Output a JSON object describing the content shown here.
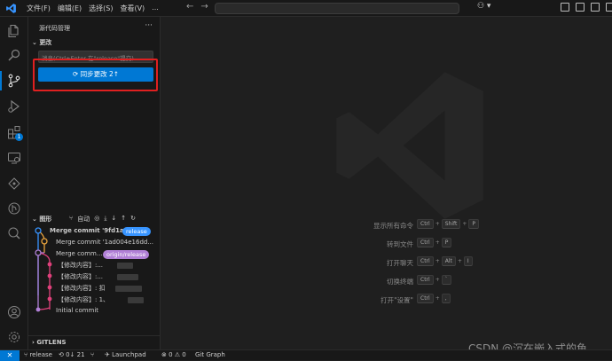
{
  "titlebar": {
    "menu": [
      "文件(F)",
      "编辑(E)",
      "选择(S)",
      "查看(V)",
      "..."
    ],
    "back": "←",
    "forward": "→",
    "copilot": "⚇ ▾"
  },
  "activity": {
    "scm_badge": "",
    "extensions_badge": "1"
  },
  "sidebar": {
    "title": "源代码管理",
    "more": "···",
    "changes_header": "更改",
    "message_placeholder": "消息(Ctrl+Enter 在\"release\"提交)",
    "sync_button": "⟳ 同步更改 2↑",
    "graph_header": "图形",
    "graph_auto": "自动",
    "graph_rows": [
      {
        "text": "Merge commit '9fd1a...",
        "ref": "release",
        "ref_color": "#3794ff"
      },
      {
        "text": "Merge commit '1ad004e16dd..."
      },
      {
        "text": "Merge comm...",
        "ref": "origin/release",
        "ref_color": "#b180d7"
      },
      {
        "text": "【修改内容】:..."
      },
      {
        "text": "【修改内容】:..."
      },
      {
        "text": "【修改内容】:  扣"
      },
      {
        "text": "【修改内容】:  1、"
      },
      {
        "text": "Initial commit"
      }
    ],
    "gitlens": "GITLENS"
  },
  "editor": {
    "shortcuts": [
      {
        "label": "显示所有命令",
        "keys": [
          "Ctrl",
          "Shift",
          "P"
        ]
      },
      {
        "label": "转到文件",
        "keys": [
          "Ctrl",
          "P"
        ]
      },
      {
        "label": "打开聊天",
        "keys": [
          "Ctrl",
          "Alt",
          "I"
        ]
      },
      {
        "label": "切换终端",
        "keys": [
          "Ctrl",
          "`"
        ]
      },
      {
        "label": "打开\"设置\"",
        "keys": [
          "Ctrl",
          ","
        ]
      }
    ],
    "watermark_text": "CSDN @沉在嵌入式的鱼"
  },
  "statusbar": {
    "remote": "✕",
    "branch": "release",
    "sync": "⟲ 0↓ 21",
    "launchpad": "Launchpad",
    "problems": "⊗ 0 ⚠ 0",
    "git_graph": "Git Graph"
  },
  "colors": {
    "accent": "#0078d4",
    "highlight_box": "#e02020",
    "graph_blue": "#3794ff",
    "graph_orange": "#e8a33d",
    "graph_purple": "#b180d7",
    "graph_pink": "#e0407b"
  }
}
